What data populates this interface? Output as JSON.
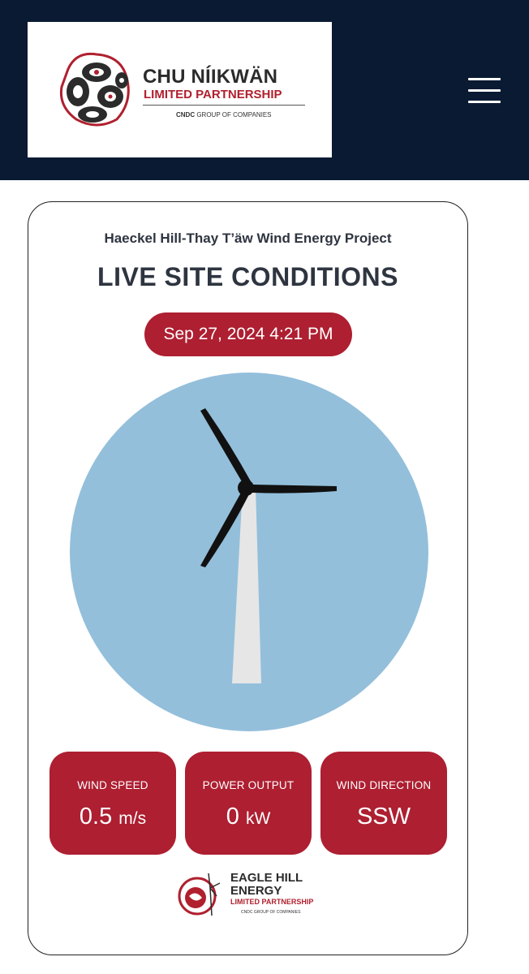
{
  "header": {
    "logo": {
      "title": "CHU NÍIKWÄN",
      "subtitle": "LIMITED PARTNERSHIP",
      "group_bold": "CNDC",
      "group_rest": " GROUP OF COMPANIES"
    },
    "menu_icon": "hamburger-menu-icon"
  },
  "card": {
    "project_name": "Haeckel Hill-Thay T’äw Wind Energy Project",
    "heading": "LIVE SITE CONDITIONS",
    "timestamp": "Sep 27, 2024 4:21 PM",
    "turbine_icon": "wind-turbine-icon",
    "stats": [
      {
        "label": "WIND SPEED",
        "value": "0.5",
        "unit": "m/s"
      },
      {
        "label": "POWER OUTPUT",
        "value": "0",
        "unit": "kW"
      },
      {
        "label": "WIND DIRECTION",
        "value": "SSW",
        "unit": ""
      }
    ],
    "footer_logo": {
      "line1": "EAGLE HILL",
      "line2": "ENERGY",
      "line3": "LIMITED PARTNERSHIP",
      "line4": "CNDC GROUP OF COMPANIES"
    }
  },
  "colors": {
    "header_bg": "#0a1a33",
    "accent_red": "#ad1f31",
    "sky_blue": "#93bfdb",
    "heading_text": "#2e3540"
  }
}
